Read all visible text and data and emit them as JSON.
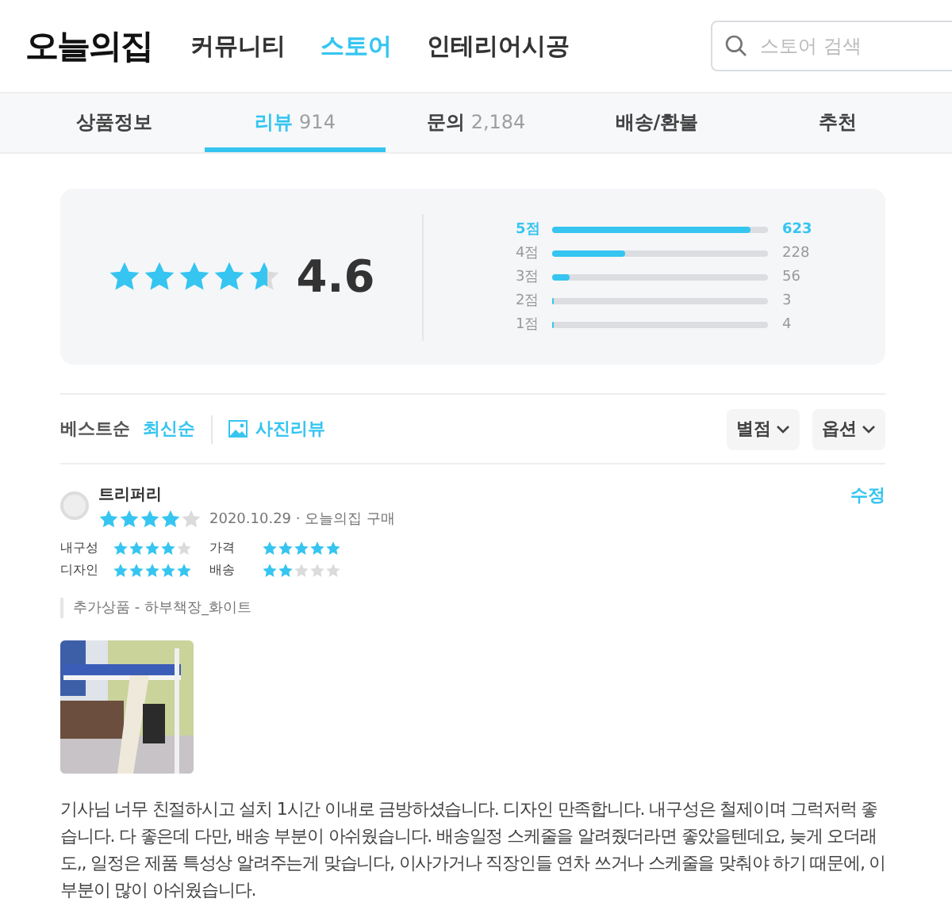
{
  "header": {
    "logo": "오늘의집",
    "nav": [
      {
        "label": "커뮤니티",
        "selected": false
      },
      {
        "label": "스토어",
        "selected": true
      },
      {
        "label": "인테리어시공",
        "selected": false
      }
    ],
    "search": {
      "placeholder": "스토어 검색"
    }
  },
  "tabs": [
    {
      "label": "상품정보",
      "selected": false
    },
    {
      "label": "리뷰",
      "count": "914",
      "selected": true
    },
    {
      "label": "문의",
      "count": "2,184",
      "selected": false
    },
    {
      "label": "배송/환불",
      "selected": false
    },
    {
      "label": "추천",
      "selected": false
    }
  ],
  "summary": {
    "stars": 4.6,
    "score": "4.6",
    "distribution": [
      {
        "label": "5점",
        "level": 0.92,
        "count": "623",
        "highlighted": true
      },
      {
        "label": "4점",
        "level": 0.34,
        "count": "228",
        "highlighted": false
      },
      {
        "label": "3점",
        "level": 0.08,
        "count": "56",
        "highlighted": false
      },
      {
        "label": "2점",
        "level": 0.01,
        "count": "3",
        "highlighted": false
      },
      {
        "label": "1점",
        "level": 0.01,
        "count": "4",
        "highlighted": false
      }
    ]
  },
  "filters": {
    "sort": [
      {
        "label": "베스트순",
        "selected": false
      },
      {
        "label": "최신순",
        "selected": true
      }
    ],
    "photo_review": "사진리뷰",
    "dropdowns": [
      "별점",
      "옵션"
    ]
  },
  "review": {
    "author": "트리퍼리",
    "edit": "수정",
    "stars": 4,
    "meta": "2020.10.29 · 오늘의집 구매",
    "ratings": [
      {
        "label": "내구성",
        "stars": 4
      },
      {
        "label": "가격",
        "stars": 5
      },
      {
        "label": "디자인",
        "stars": 5
      },
      {
        "label": "배송",
        "stars": 2
      }
    ],
    "option": "추가상품 - 하부책장_화이트",
    "text": "기사님 너무 친절하시고 설치 1시간 이내로 금방하셨습니다. 디자인 만족합니다. 내구성은 철제이며 그럭저럭 좋습니다. 다 좋은데 다만, 배송 부분이 아쉬웠습니다. 배송일정 스케줄을 알려줬더라면 좋았을텐데요, 늦게 오더래도,, 일정은 제품 특성상 알려주는게 맞습니다, 이사가거나 직장인들 연차 쓰거나 스케줄을 맞춰야 하기 때문에, 이 부분이 많이 아쉬웠습니다."
  }
}
